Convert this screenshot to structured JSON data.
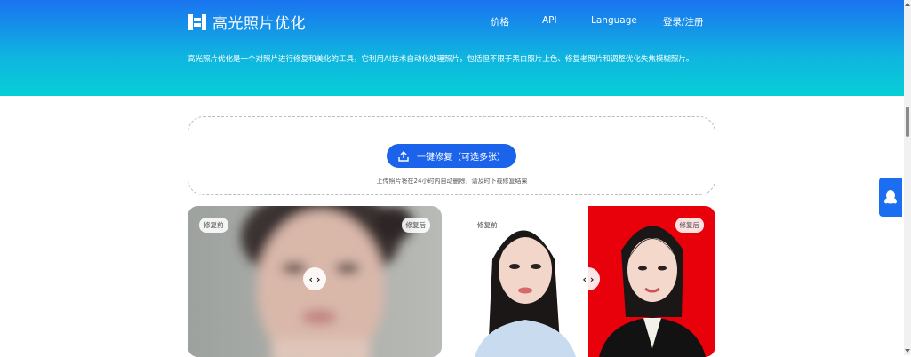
{
  "header": {
    "brand": "高光照片优化",
    "nav": [
      "价格",
      "API",
      "Language",
      "登录/注册"
    ],
    "tagline": "高光照片优化是一个对照片进行修复和美化的工具，它利用AI技术自动化处理照片，包括但不限于黑白照片上色、修复老照片和调整优化失焦模糊照片。"
  },
  "upload": {
    "button_label": "一键修复（可选多张）",
    "note": "上传照片将在24小时内自动删除，请及时下载修复结果"
  },
  "samples": [
    {
      "before_label": "修复前",
      "after_label": "修复后"
    },
    {
      "before_label": "修复前",
      "after_label": "修复后"
    }
  ],
  "colors": {
    "brand_blue": "#1b63ea",
    "hero_top": "#1a73f0",
    "hero_bottom": "#06cfd6",
    "red_bg": "#e8000a"
  },
  "icons": {
    "logo": "logo-mark-icon",
    "upload": "upload-icon",
    "compare": "compare-arrows-icon",
    "qq": "qq-penguin-icon"
  }
}
